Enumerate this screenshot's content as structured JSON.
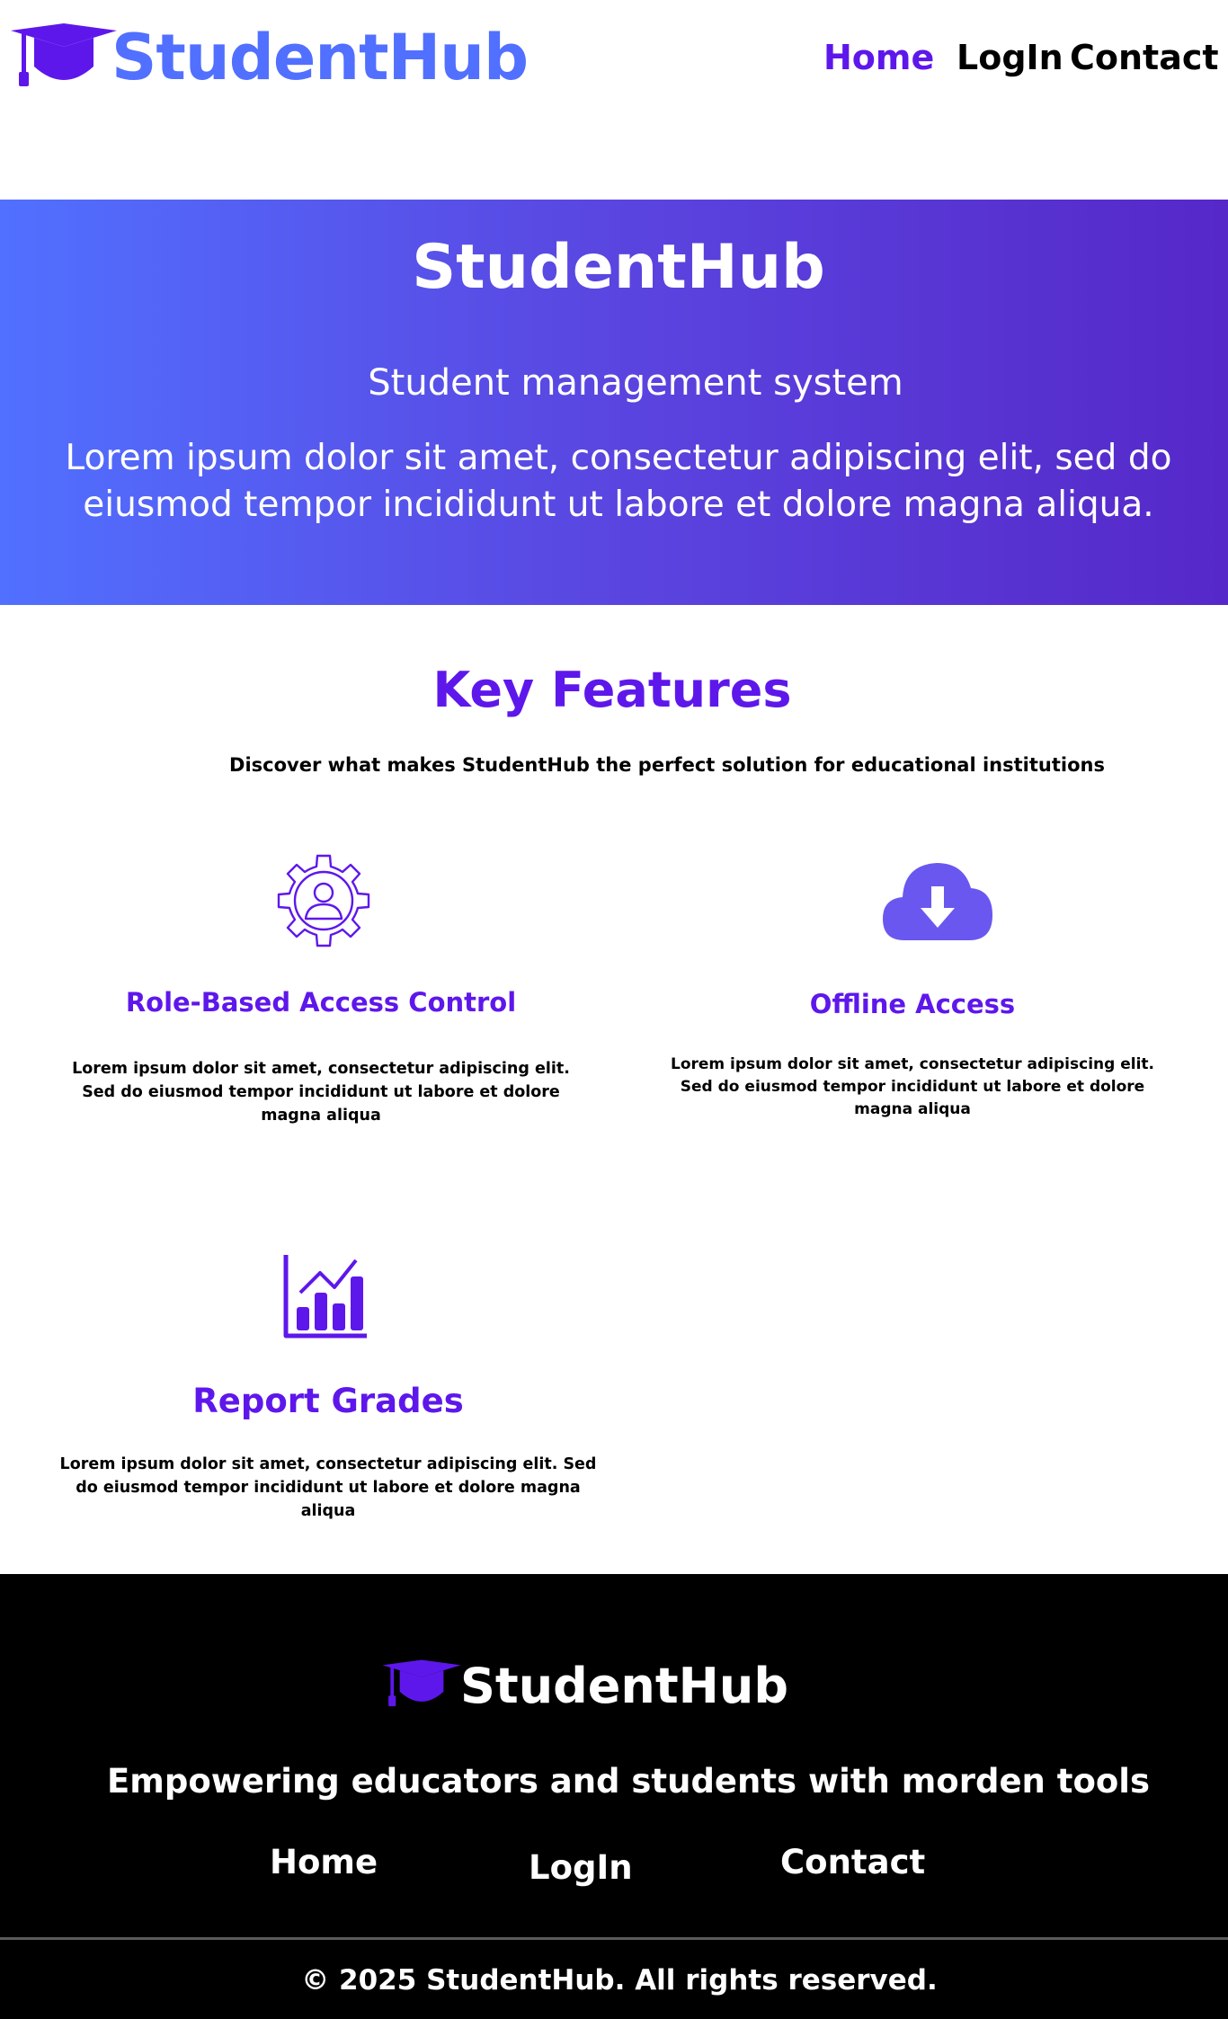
{
  "header": {
    "brand": "StudentHub",
    "logo_icon": "graduation-cap-icon",
    "nav": {
      "home": "Home",
      "login": "LogIn",
      "contact": "Contact"
    }
  },
  "hero": {
    "title": "StudentHub",
    "subtitle": "Student management system",
    "description": "Lorem ipsum dolor sit amet, consectetur adipiscing elit, sed do eiusmod tempor incididunt ut labore et dolore magna aliqua."
  },
  "features": {
    "title": "Key Features",
    "subtitle": "Discover what makes StudentHub the perfect solution for educational institutions",
    "items": [
      {
        "icon": "user-gear-icon",
        "title": "Role-Based Access Control",
        "description": "Lorem ipsum dolor sit amet, consectetur adipiscing elit. Sed do eiusmod tempor incididunt ut labore et dolore magna aliqua"
      },
      {
        "icon": "cloud-download-icon",
        "title": "Offline Access",
        "description": "Lorem ipsum dolor sit amet, consectetur adipiscing elit. Sed do eiusmod tempor incididunt ut labore et dolore magna aliqua"
      },
      {
        "icon": "bar-chart-icon",
        "title": "Report Grades",
        "description": "Lorem ipsum dolor sit amet, consectetur adipiscing elit. Sed do eiusmod tempor incididunt ut labore et dolore magna aliqua"
      }
    ]
  },
  "footer": {
    "brand": "StudentHub",
    "tagline": "Empowering  educators and students with morden tools",
    "nav": {
      "home": "Home",
      "login": "LogIn",
      "contact": "Contact"
    },
    "copyright": "© 2025 StudentHub. All rights reserved."
  },
  "colors": {
    "brand_blue": "#5170ff",
    "accent_purple": "#5e17eb",
    "hero_gradient_start": "#5170ff",
    "hero_gradient_end": "#5628c9",
    "footer_bg": "#000000"
  }
}
